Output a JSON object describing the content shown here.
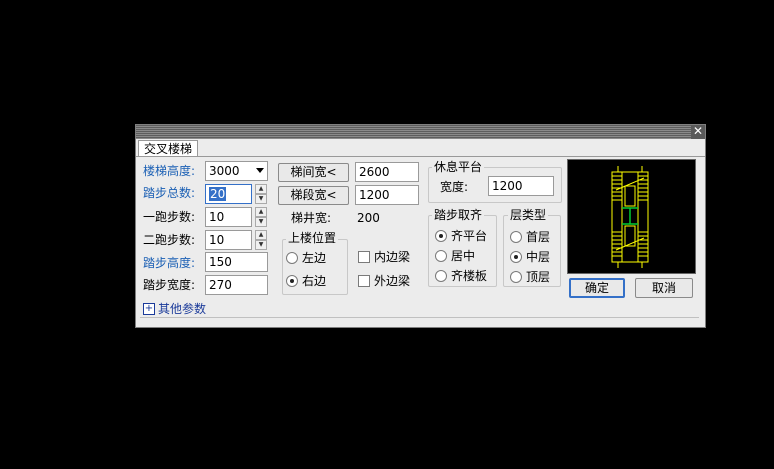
{
  "dialog": {
    "tab_label": "交叉楼梯",
    "close_glyph": "✕"
  },
  "fields": {
    "stair_height": {
      "label": "楼梯高度:",
      "value": "3000"
    },
    "total_steps": {
      "label": "踏步总数:",
      "value": "20"
    },
    "first_run_steps": {
      "label": "一跑步数:",
      "value": "10"
    },
    "second_run_steps": {
      "label": "二跑步数:",
      "value": "10"
    },
    "step_height": {
      "label": "踏步高度:",
      "value": "150"
    },
    "step_width": {
      "label": "踏步宽度:",
      "value": "270"
    }
  },
  "widths": {
    "stairwell_width_button": "梯间宽<",
    "stairwell_width_value": "2600",
    "flight_width_button": "梯段宽<",
    "flight_width_value": "1200",
    "well_width_label": "梯井宽:",
    "well_width_value": "200"
  },
  "upstairs_position": {
    "title": "上楼位置",
    "options": [
      "左边",
      "右边"
    ],
    "selected": "右边"
  },
  "beams": {
    "inner_beam": "内边梁",
    "outer_beam": "外边梁"
  },
  "landing": {
    "title": "休息平台",
    "width_label": "宽度:",
    "width_value": "1200"
  },
  "step_alignment": {
    "title": "踏步取齐",
    "options": [
      "齐平台",
      "居中",
      "齐楼板"
    ],
    "selected": "齐平台"
  },
  "floor_type": {
    "title": "层类型",
    "options": [
      "首层",
      "中层",
      "顶层"
    ],
    "selected": "中层"
  },
  "buttons": {
    "ok": "确定",
    "cancel": "取消"
  },
  "other_params": {
    "expander": "+",
    "label": "其他参数"
  },
  "colors": {
    "label_blue": "#1a5fb4",
    "preview_lines": "#ffff00",
    "preview_accent": "#00cc33"
  },
  "icons": [
    "close-icon",
    "dropdown-arrow-icon",
    "spin-up-icon",
    "spin-down-icon",
    "expand-plus-icon"
  ]
}
